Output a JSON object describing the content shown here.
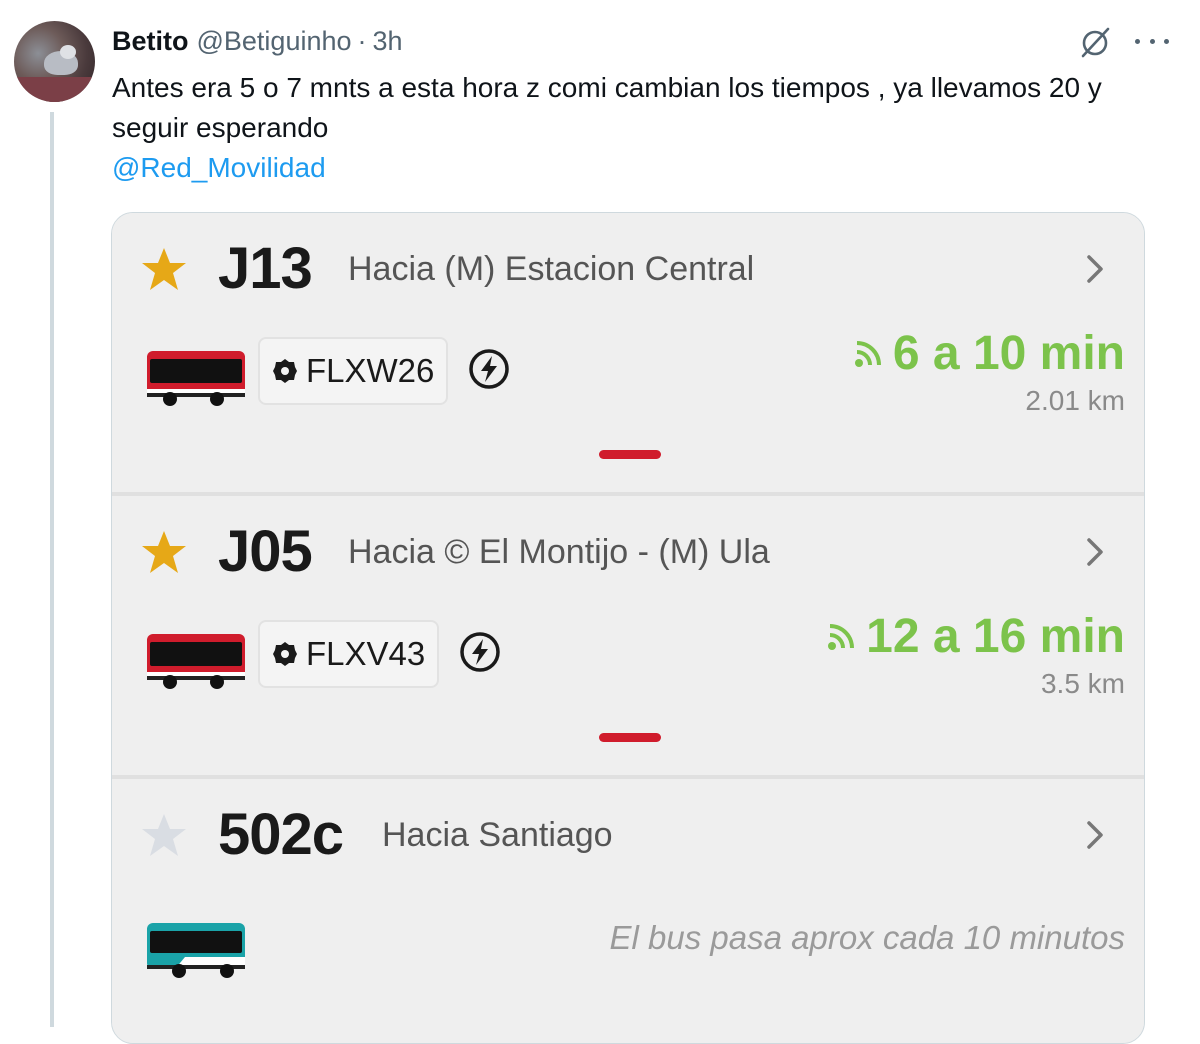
{
  "tweet": {
    "author_name": "Betito",
    "author_handle": "@Betiguinho",
    "separator": "·",
    "time": "3h",
    "text": "Antes era 5 o 7 mnts a esta hora z comi cambian los tiempos , ya llevamos 20 y seguir esperando",
    "mention": "@Red_Movilidad"
  },
  "icons": {
    "grok": "grok-icon",
    "more": "more-options-icon",
    "favorite": "star-icon",
    "chevron": "chevron-right-icon",
    "bus": "bus-icon",
    "plate": "shield-icon",
    "electric": "lightning-bolt-icon",
    "realtime": "signal-icon"
  },
  "colors": {
    "accent_link": "#1d9bf0",
    "eta_green": "#7cc34b",
    "star_gold": "#e6a817",
    "star_grey": "#d9dde3",
    "red_bus": "#d01c2c",
    "teal_bus": "#1aa3a8"
  },
  "routes": [
    {
      "number": "J13",
      "destination": "Hacia (M) Estacion Central",
      "favorite": true,
      "plate": "FLXW26",
      "eta": "6 a 10 min",
      "distance": "2.01 km"
    },
    {
      "number": "J05",
      "destination": "Hacia © El Montijo - (M) Ula",
      "favorite": true,
      "plate": "FLXV43",
      "eta": "12 a 16 min",
      "distance": "3.5 km"
    },
    {
      "number": "502c",
      "destination": "Hacia Santiago",
      "favorite": false,
      "frequency": "El bus pasa aprox cada 10 minutos"
    }
  ]
}
